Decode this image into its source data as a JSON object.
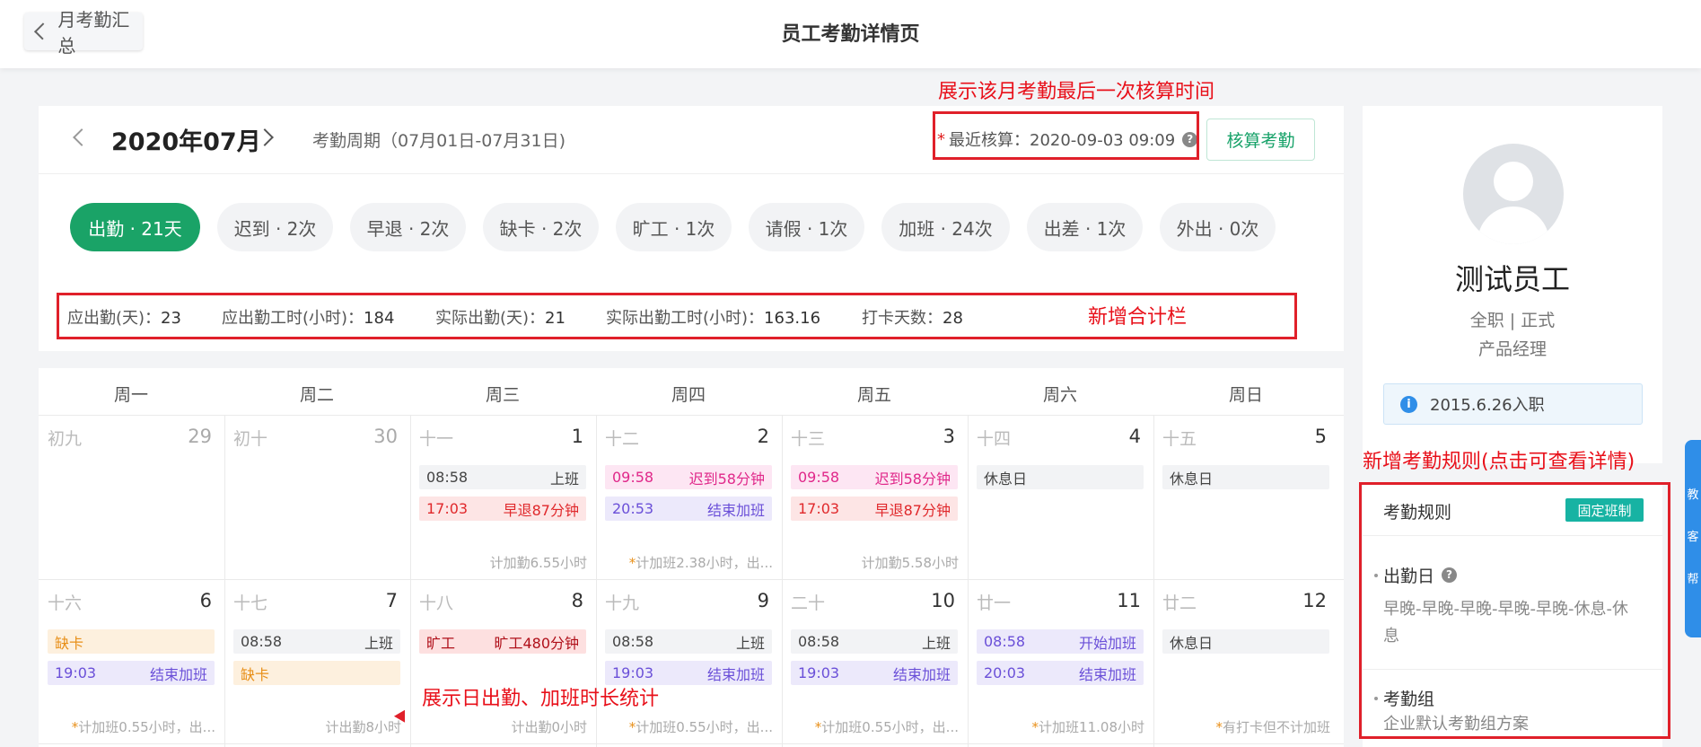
{
  "header": {
    "back_label": "月考勤汇总",
    "title": "员工考勤详情页"
  },
  "annotations": {
    "recalc_note": "展示该月考勤最后一次核算时间",
    "summary_note": "新增合计栏",
    "rules_note": "新增考勤规则(点击可查看详情)",
    "daily_note": "展示日出勤、加班时长统计"
  },
  "month": {
    "label": "2020年07月",
    "period": "考勤周期（07月01日-07月31日)",
    "recalc_label": "最近核算：2020-09-03 09:09",
    "recalc_button": "核算考勤"
  },
  "pills": [
    {
      "label": "出勤 · 21天",
      "active": true
    },
    {
      "label": "迟到 · 2次"
    },
    {
      "label": "早退 · 2次"
    },
    {
      "label": "缺卡 · 2次"
    },
    {
      "label": "旷工 · 1次"
    },
    {
      "label": "请假 · 1次"
    },
    {
      "label": "加班 · 24次"
    },
    {
      "label": "出差 · 1次"
    },
    {
      "label": "外出 · 0次"
    }
  ],
  "stats": [
    {
      "label": "应出勤(天)：",
      "value": "23"
    },
    {
      "label": "应出勤工时(小时)：",
      "value": "184"
    },
    {
      "label": "实际出勤(天)：",
      "value": "21"
    },
    {
      "label": "实际出勤工时(小时)：",
      "value": "163.16"
    },
    {
      "label": "打卡天数：",
      "value": "28"
    }
  ],
  "weekdays": [
    "周一",
    "周二",
    "周三",
    "周四",
    "周五",
    "周六",
    "周日"
  ],
  "week1": [
    {
      "lunar": "初九",
      "num": "29",
      "dim": true
    },
    {
      "lunar": "初十",
      "num": "30",
      "dim": true
    },
    {
      "lunar": "十一",
      "num": "1",
      "events": [
        {
          "t": "08:58",
          "s": "上班",
          "c": "gray"
        },
        {
          "t": "17:03",
          "s": "早退87分钟",
          "c": "red"
        }
      ],
      "note": "计加勤6.55小时"
    },
    {
      "lunar": "十二",
      "num": "2",
      "events": [
        {
          "t": "09:58",
          "s": "迟到58分钟",
          "c": "pink"
        },
        {
          "t": "20:53",
          "s": "结束加班",
          "c": "purple"
        }
      ],
      "note": "计加班2.38小时，出...",
      "star": true
    },
    {
      "lunar": "十三",
      "num": "3",
      "events": [
        {
          "t": "09:58",
          "s": "迟到58分钟",
          "c": "pink"
        },
        {
          "t": "17:03",
          "s": "早退87分钟",
          "c": "red"
        }
      ],
      "note": "计加勤5.58小时"
    },
    {
      "lunar": "十四",
      "num": "4",
      "events": [
        {
          "t": "休息日",
          "s": "",
          "c": "gray"
        }
      ]
    },
    {
      "lunar": "十五",
      "num": "5",
      "events": [
        {
          "t": "休息日",
          "s": "",
          "c": "gray"
        }
      ]
    }
  ],
  "week2": [
    {
      "lunar": "十六",
      "num": "6",
      "events": [
        {
          "t": "缺卡",
          "s": "",
          "c": "orange"
        },
        {
          "t": "19:03",
          "s": "结束加班",
          "c": "purple"
        }
      ],
      "note": "计加班0.55小时，出...",
      "star": true
    },
    {
      "lunar": "十七",
      "num": "7",
      "events": [
        {
          "t": "08:58",
          "s": "上班",
          "c": "gray"
        },
        {
          "t": "缺卡",
          "s": "",
          "c": "orange"
        }
      ],
      "note": "计出勤8小时"
    },
    {
      "lunar": "十八",
      "num": "8",
      "events": [
        {
          "t": "旷工",
          "s": "旷工480分钟",
          "c": "darkred"
        }
      ],
      "note": "计出勤0小时"
    },
    {
      "lunar": "十九",
      "num": "9",
      "events": [
        {
          "t": "08:58",
          "s": "上班",
          "c": "gray"
        },
        {
          "t": "19:03",
          "s": "结束加班",
          "c": "purple"
        }
      ],
      "note": "计加班0.55小时，出...",
      "star": true
    },
    {
      "lunar": "二十",
      "num": "10",
      "events": [
        {
          "t": "08:58",
          "s": "上班",
          "c": "gray"
        },
        {
          "t": "19:03",
          "s": "结束加班",
          "c": "purple"
        }
      ],
      "note": "计加班0.55小时，出...",
      "star": true
    },
    {
      "lunar": "廿一",
      "num": "11",
      "events": [
        {
          "t": "08:58",
          "s": "开始加班",
          "c": "purple"
        },
        {
          "t": "20:03",
          "s": "结束加班",
          "c": "purple"
        }
      ],
      "note": "计加班11.08小时",
      "star": true
    },
    {
      "lunar": "廿二",
      "num": "12",
      "events": [
        {
          "t": "休息日",
          "s": "",
          "c": "gray"
        }
      ],
      "note": "有打卡但不计加班",
      "star": true
    }
  ],
  "profile": {
    "name": "测试员工",
    "type": "全职 | 正式",
    "position": "产品经理",
    "hire": "2015.6.26入职"
  },
  "rules": {
    "title": "考勤规则",
    "tag": "固定班制",
    "workday_head": "出勤日",
    "workday_text": "早晚-早晚-早晚-早晚-早晚-休息-休息",
    "group_head": "考勤组",
    "group_text": "企业默认考勤组方案"
  },
  "side_tabs": [
    "教",
    "客",
    "帮"
  ]
}
